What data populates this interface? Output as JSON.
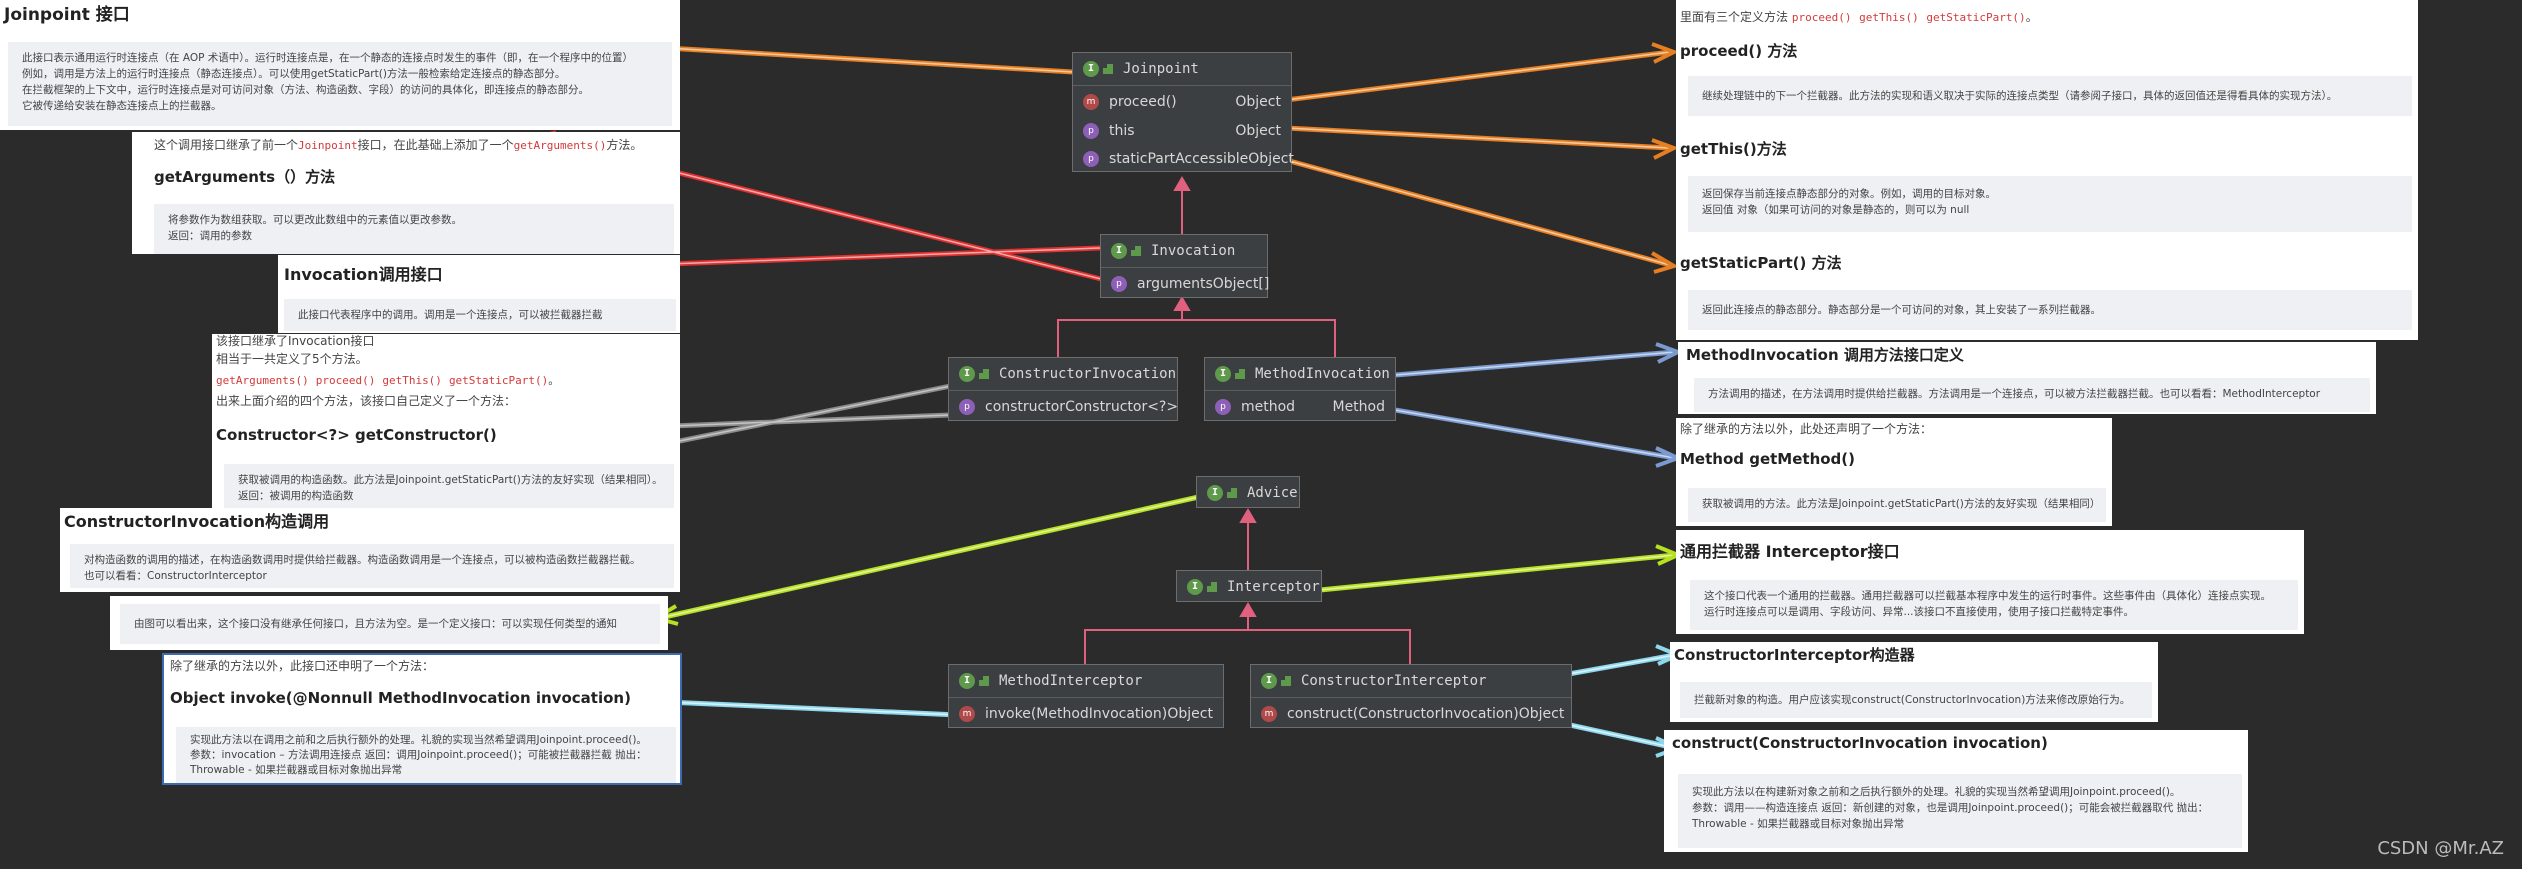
{
  "uml": {
    "joinpoint": {
      "name": "Joinpoint",
      "rows": [
        {
          "n": "proceed()",
          "t": "Object"
        },
        {
          "n": "this",
          "t": "Object"
        },
        {
          "n": "staticPart",
          "t": "AccessibleObject"
        }
      ]
    },
    "invocation": {
      "name": "Invocation",
      "rows": [
        {
          "n": "arguments",
          "t": "Object[]"
        }
      ]
    },
    "constructorInvocation": {
      "name": "ConstructorInvocation",
      "rows": [
        {
          "n": "constructor",
          "t": "Constructor<?>"
        }
      ]
    },
    "methodInvocation": {
      "name": "MethodInvocation",
      "rows": [
        {
          "n": "method",
          "t": "Method"
        }
      ]
    },
    "advice": {
      "name": "Advice"
    },
    "interceptor": {
      "name": "Interceptor"
    },
    "methodInterceptor": {
      "name": "MethodInterceptor",
      "rows": [
        {
          "n": "invoke(MethodInvocation)",
          "t": "Object"
        }
      ]
    },
    "constructorInterceptor": {
      "name": "ConstructorInterceptor",
      "rows": [
        {
          "n": "construct(ConstructorInvocation)",
          "t": "Object"
        }
      ]
    }
  },
  "notes": {
    "joinpoint": {
      "title": "Joinpoint 接口",
      "lines": [
        "此接口表示通用运行时连接点（在 AOP 术语中）。运行时连接点是，在一个静态的连接点时发生的事件（即，在一个程序中的位置）",
        "例如，调用是方法上的运行时连接点（静态连接点）。可以使用getStaticPart()方法一般检索给定连接点的静态部分。",
        "在拦截框架的上下文中，运行时连接点是对可访问对象（方法、构造函数、字段）的访问的具体化，即连接点的静态部分。",
        "它被传递给安装在静态连接点上的拦截器。"
      ]
    },
    "getArguments": {
      "intro_pre": "这个调用接口继承了前一个",
      "intro_code": "Joinpoint",
      "intro_mid": "接口，在此基础上添加了一个",
      "intro_code2": "getArguments()",
      "intro_post": "方法。",
      "title": "getArguments（）方法",
      "lines": [
        "将参数作为数组获取。可以更改此数组中的元素值以更改参数。",
        "返回：调用的参数"
      ]
    },
    "invocation": {
      "title": "Invocation调用接口",
      "line": "此接口代表程序中的调用。调用是一个连接点，可以被拦截器拦截"
    },
    "getConstructor": {
      "l1": "该接口继承了Invocation接口",
      "l2": "相当于一共定义了5个方法。",
      "codes": [
        "getArguments()",
        "proceed()",
        "getThis()",
        "getStaticPart()"
      ],
      "l4": "出来上面介绍的四个方法，该接口自己定义了一个方法：",
      "title": "Constructor<?> getConstructor()",
      "lines": [
        "获取被调用的构造函数。此方法是Joinpoint.getStaticPart()方法的友好实现（结果相同）。",
        "返回：被调用的构造函数"
      ]
    },
    "constructorInvocation": {
      "title": "ConstructorInvocation构造调用",
      "lines": [
        "对构造函数的调用的描述，在构造函数调用时提供给拦截器。构造函数调用是一个连接点，可以被构造函数拦截器拦截。",
        "也可以看看：ConstructorInterceptor"
      ]
    },
    "advice": {
      "line": "由图可以看出来，这个接口没有继承任何接口，且方法为空。是一个定义接口：可以实现任何类型的通知"
    },
    "invoke": {
      "intro": "除了继承的方法以外，此接口还申明了一个方法：",
      "title": "Object invoke(@Nonnull MethodInvocation invocation)",
      "lines": [
        "实现此方法以在调用之前和之后执行额外的处理。礼貌的实现当然希望调用Joinpoint.proceed()。",
        "参数：invocation – 方法调用连接点 返回：调用Joinpoint.proceed()；可能被拦截器拦截 抛出：",
        "Throwable - 如果拦截器或目标对象抛出异常"
      ]
    },
    "defs": {
      "intro": "里面有三个定义方法",
      "codes": [
        "proceed()",
        "getThis()",
        "getStaticPart()"
      ],
      "intro_end": "。",
      "proceed_title": "proceed() 方法",
      "proceed_line": "继续处理链中的下一个拦截器。此方法的实现和语义取决于实际的连接点类型（请参阅子接口，具体的返回值还是得看具体的实现方法）。",
      "getThis_title": "getThis()方法",
      "getThis_lines": [
        "返回保存当前连接点静态部分的对象。例如，调用的目标对象。",
        "返回值 对象（如果可访问的对象是静态的，则可以为 null"
      ],
      "getStaticPart_title": "getStaticPart() 方法",
      "getStaticPart_line": "返回此连接点的静态部分。静态部分是一个可访问的对象，其上安装了一系列拦截器。"
    },
    "methodInvocation": {
      "title": "MethodInvocation 调用方法接口定义",
      "line": "方法调用的描述，在方法调用时提供给拦截器。方法调用是一个连接点，可以被方法拦截器拦截。也可以看看：MethodInterceptor"
    },
    "getMethod": {
      "intro": "除了继承的方法以外，此处还声明了一个方法：",
      "title": "Method getMethod()",
      "line": "获取被调用的方法。此方法是Joinpoint.getStaticPart()方法的友好实现（结果相同）"
    },
    "interceptor": {
      "title": "通用拦截器 Interceptor接口",
      "lines": [
        "这个接口代表一个通用的拦截器。通用拦截器可以拦截基本程序中发生的运行时事件。这些事件由（具体化）连接点实现。",
        "运行时连接点可以是调用、字段访问、异常...该接口不直接使用，使用子接口拦截特定事件。"
      ]
    },
    "constructorInterceptor": {
      "title": "ConstructorInterceptor构造器",
      "line": "拦截新对象的构造。用户应该实现construct(ConstructorInvocation)方法来修改原始行为。"
    },
    "construct": {
      "title": "construct(ConstructorInvocation invocation)",
      "lines": [
        "实现此方法以在构建新对象之前和之后执行额外的处理。礼貌的实现当然希望调用Joinpoint.proceed()。",
        "参数：调用——构造连接点 返回：新创建的对象，也是调用Joinpoint.proceed()；可能会被拦截器取代 抛出：",
        "Throwable - 如果拦截器或目标对象抛出异常"
      ]
    }
  },
  "watermark": "CSDN @Mr.AZ",
  "colors": {
    "orange": "#e67e22",
    "red": "#e03030",
    "gray": "#8a8a8a",
    "blue": "#7a9ad0",
    "lime": "#b6e020",
    "cyan": "#8ed8ee",
    "pink": "#e0607e"
  }
}
